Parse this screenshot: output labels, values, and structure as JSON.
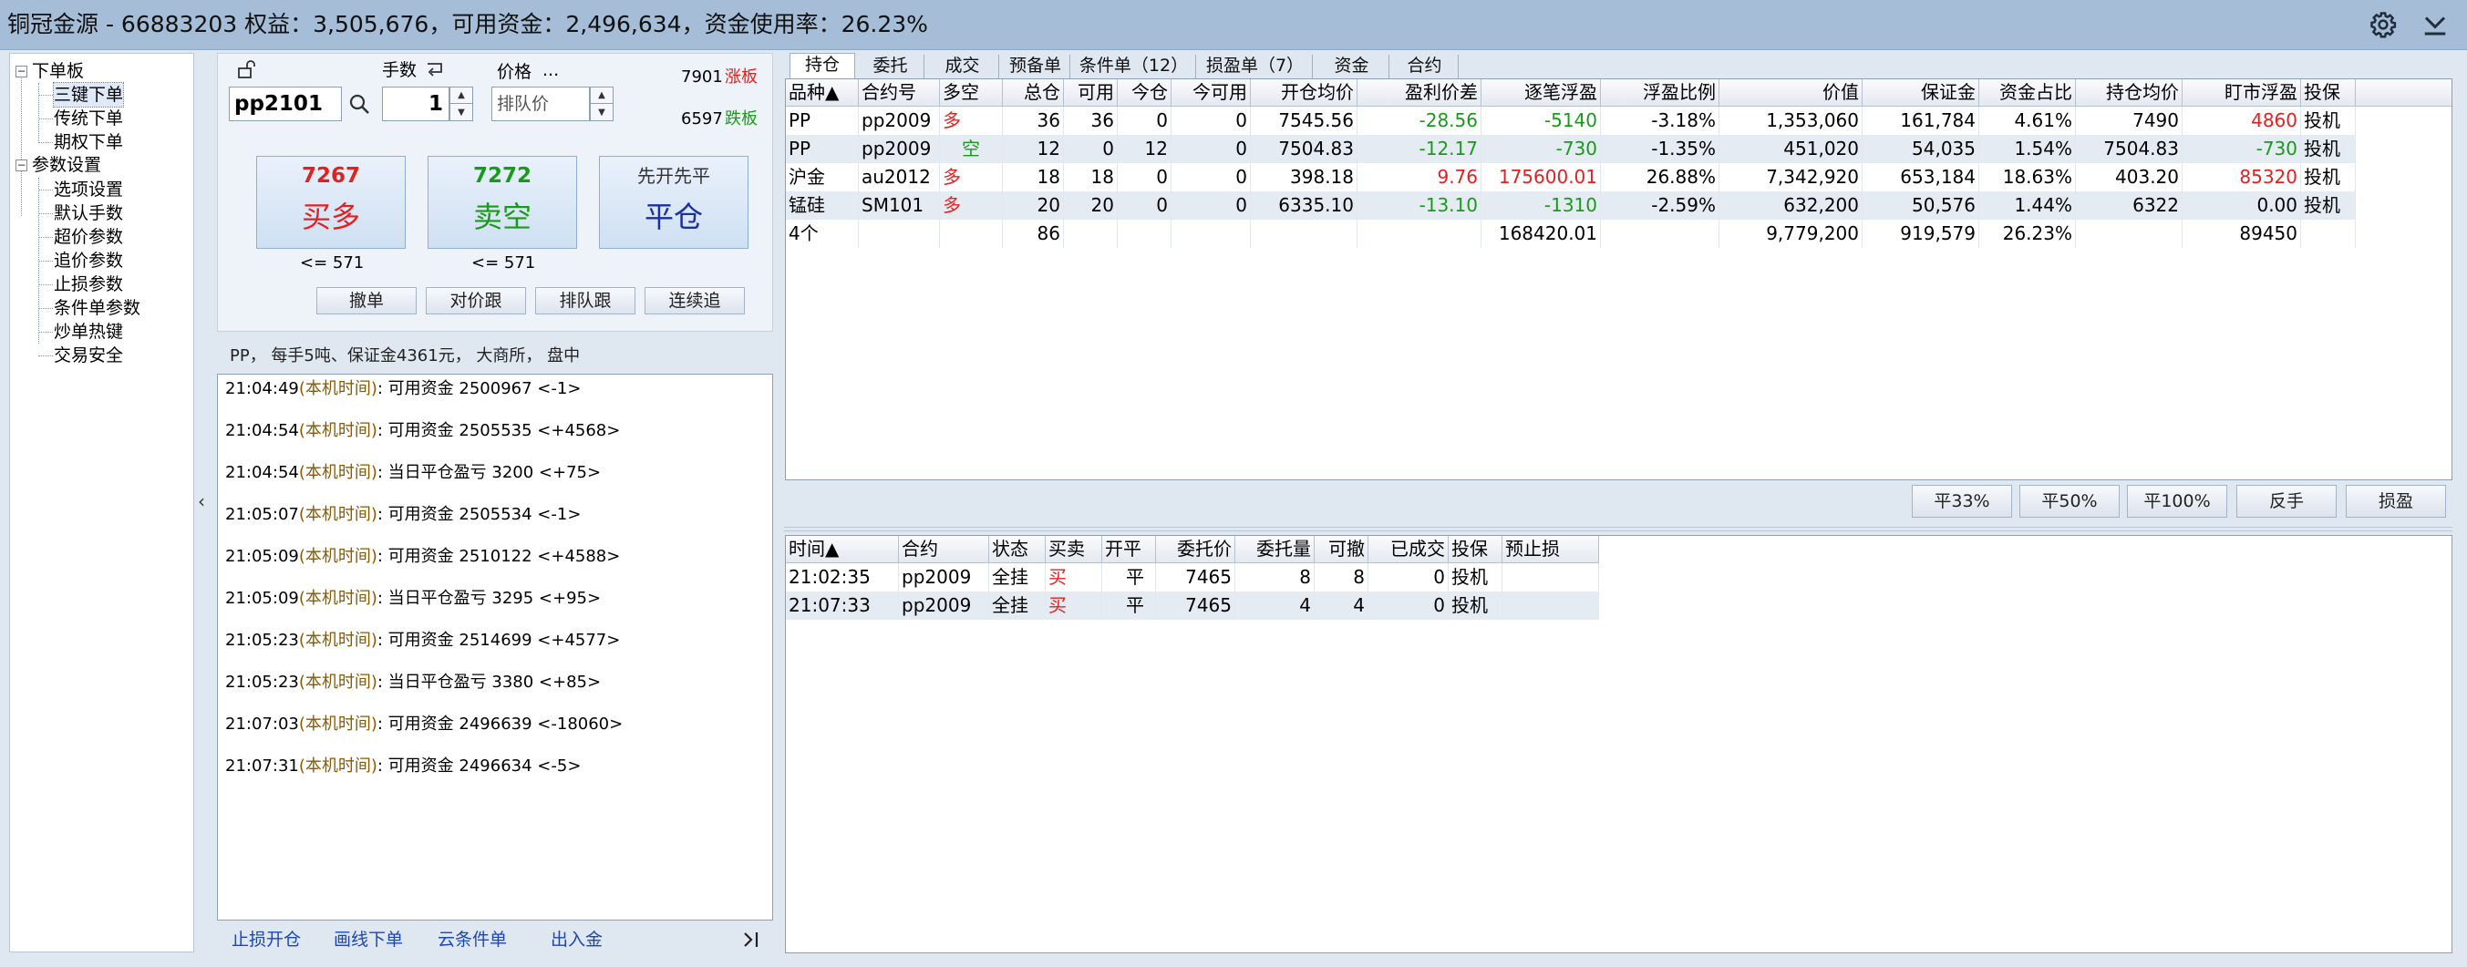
{
  "titlebar": {
    "title": "铜冠金源 - 66883203  权益：3,505,676，可用资金：2,496,634，资金使用率：26.23%"
  },
  "tree": {
    "group1": "下单板",
    "group1_items": [
      "三键下单",
      "传统下单",
      "期权下单"
    ],
    "group2": "参数设置",
    "group2_items": [
      "选项设置",
      "默认手数",
      "超价参数",
      "追价参数",
      "止损参数",
      "条件单参数",
      "炒单热键",
      "交易安全"
    ],
    "expanded_sign": "−"
  },
  "order": {
    "lot_label": "手数",
    "price_label": "价格",
    "price_more": "...",
    "contract": "pp2101",
    "qty": "1",
    "price_placeholder": "排队价",
    "limit_up_price": "7901",
    "limit_up_label": "涨板",
    "limit_down_price": "6597",
    "limit_down_label": "跌板",
    "buy_price": "7267",
    "buy_label": "买多",
    "sell_price": "7272",
    "sell_label": "卖空",
    "close_top": "先开先平",
    "close_label": "平仓",
    "buy_limit": "<= 571",
    "sell_limit": "<= 571",
    "btn_cancel": "撤单",
    "btn_follow": "对价跟",
    "btn_queue": "排队跟",
    "btn_chase": "连续追",
    "info": "PP， 每手5吨、保证金4361元， 大商所， 盘中"
  },
  "log": [
    {
      "time": "21:04:49",
      "tag": "(本机时间)",
      "msg": ": 可用资金 2500967  <-1>"
    },
    {
      "time": "21:04:54",
      "tag": "(本机时间)",
      "msg": ": 可用资金 2505535  <+4568>"
    },
    {
      "time": "21:04:54",
      "tag": "(本机时间)",
      "msg": ": 当日平仓盈亏 3200  <+75>"
    },
    {
      "time": "21:05:07",
      "tag": "(本机时间)",
      "msg": ": 可用资金 2505534  <-1>"
    },
    {
      "time": "21:05:09",
      "tag": "(本机时间)",
      "msg": ": 可用资金 2510122  <+4588>"
    },
    {
      "time": "21:05:09",
      "tag": "(本机时间)",
      "msg": ": 当日平仓盈亏 3295  <+95>"
    },
    {
      "time": "21:05:23",
      "tag": "(本机时间)",
      "msg": ": 可用资金 2514699  <+4577>"
    },
    {
      "time": "21:05:23",
      "tag": "(本机时间)",
      "msg": ": 当日平仓盈亏 3380  <+85>"
    },
    {
      "time": "21:07:03",
      "tag": "(本机时间)",
      "msg": ": 可用资金 2496639  <-18060>"
    },
    {
      "time": "21:07:31",
      "tag": "(本机时间)",
      "msg": ": 可用资金 2496634  <-5>"
    }
  ],
  "bottom_links": [
    "止损开仓",
    "画线下单",
    "云条件单",
    "出入金"
  ],
  "tabs": [
    "持仓",
    "委托",
    "成交",
    "预备单",
    "条件单（12）",
    "损盈单（7）",
    "资金",
    "合约"
  ],
  "positions": {
    "headers": [
      "品种▲",
      "合约号",
      "多空",
      "总仓",
      "可用",
      "今仓",
      "今可用",
      "开仓均价",
      "盈利价差",
      "逐笔浮盈",
      "浮盈比例",
      "价值",
      "保证金",
      "资金占比",
      "持仓均价",
      "盯市浮盈",
      "投保"
    ],
    "rows": [
      [
        "PP",
        "pp2009",
        "多",
        "36",
        "36",
        "0",
        "0",
        "7545.56",
        "-28.56",
        "-5140",
        "-3.18%",
        "1,353,060",
        "161,784",
        "4.61%",
        "7490",
        "4860",
        "投机"
      ],
      [
        "PP",
        "pp2009",
        "空",
        "12",
        "0",
        "12",
        "0",
        "7504.83",
        "-12.17",
        "-730",
        "-1.35%",
        "451,020",
        "54,035",
        "1.54%",
        "7504.83",
        "-730",
        "投机"
      ],
      [
        "沪金",
        "au2012",
        "多",
        "18",
        "18",
        "0",
        "0",
        "398.18",
        "9.76",
        "175600.01",
        "26.88%",
        "7,342,920",
        "653,184",
        "18.63%",
        "403.20",
        "85320",
        "投机"
      ],
      [
        "锰硅",
        "SM101",
        "多",
        "20",
        "20",
        "0",
        "0",
        "6335.10",
        "-13.10",
        "-1310",
        "-2.59%",
        "632,200",
        "50,576",
        "1.44%",
        "6322",
        "0.00",
        "投机"
      ]
    ],
    "total": [
      "4个",
      "",
      "",
      "86",
      "",
      "",
      "",
      "",
      "",
      "168420.01",
      "",
      "9,779,200",
      "919,579",
      "26.23%",
      "",
      "89450",
      ""
    ]
  },
  "actions": [
    "平33%",
    "平50%",
    "平100%",
    "反手",
    "损盈"
  ],
  "orders": {
    "headers": [
      "时间▲",
      "合约",
      "状态",
      "买卖",
      "开平",
      "委托价",
      "委托量",
      "可撤",
      "已成交",
      "投保",
      "预止损"
    ],
    "rows": [
      [
        "21:02:35",
        "pp2009",
        "全挂",
        "买",
        "平",
        "7465",
        "8",
        "8",
        "0",
        "投机",
        ""
      ],
      [
        "21:07:33",
        "pp2009",
        "全挂",
        "买",
        "平",
        "7465",
        "4",
        "4",
        "0",
        "投机",
        ""
      ]
    ]
  }
}
